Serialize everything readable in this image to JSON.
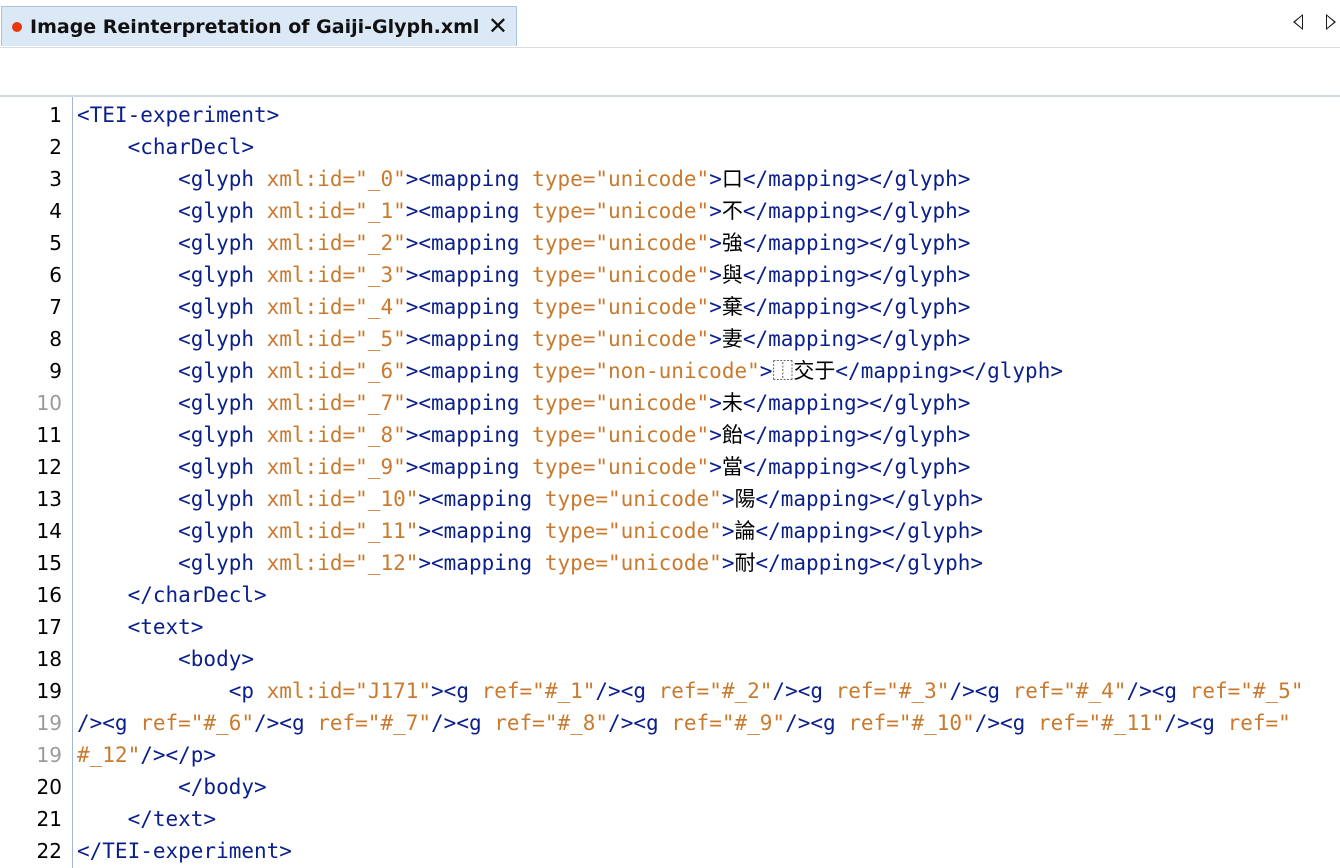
{
  "tab": {
    "title": "Image Reinterpretation of Gaiji-Glyph.xml",
    "close_label": "✕",
    "modified": true
  },
  "colors": {
    "tag": "#0b1f8a",
    "attribute": "#c97a2e",
    "text": "#000000",
    "tab_bg": "#dbe8f6",
    "modified_dot": "#e8380d"
  },
  "lines": [
    {
      "num": "1",
      "dim": false,
      "tokens": [
        {
          "t": "tag",
          "s": "<TEI-experiment>"
        }
      ]
    },
    {
      "num": "2",
      "dim": false,
      "tokens": [
        {
          "t": "tag",
          "s": "    <charDecl>"
        }
      ]
    },
    {
      "num": "3",
      "dim": false,
      "tokens": [
        {
          "t": "tag",
          "s": "        <glyph "
        },
        {
          "t": "attr",
          "s": "xml:id=\"_0\""
        },
        {
          "t": "tag",
          "s": "><mapping "
        },
        {
          "t": "attr",
          "s": "type=\"unicode\""
        },
        {
          "t": "tag",
          "s": ">"
        },
        {
          "t": "txt",
          "s": "口"
        },
        {
          "t": "tag",
          "s": "</mapping></glyph>"
        }
      ]
    },
    {
      "num": "4",
      "dim": false,
      "tokens": [
        {
          "t": "tag",
          "s": "        <glyph "
        },
        {
          "t": "attr",
          "s": "xml:id=\"_1\""
        },
        {
          "t": "tag",
          "s": "><mapping "
        },
        {
          "t": "attr",
          "s": "type=\"unicode\""
        },
        {
          "t": "tag",
          "s": ">"
        },
        {
          "t": "txt",
          "s": "不"
        },
        {
          "t": "tag",
          "s": "</mapping></glyph>"
        }
      ]
    },
    {
      "num": "5",
      "dim": false,
      "tokens": [
        {
          "t": "tag",
          "s": "        <glyph "
        },
        {
          "t": "attr",
          "s": "xml:id=\"_2\""
        },
        {
          "t": "tag",
          "s": "><mapping "
        },
        {
          "t": "attr",
          "s": "type=\"unicode\""
        },
        {
          "t": "tag",
          "s": ">"
        },
        {
          "t": "txt",
          "s": "強"
        },
        {
          "t": "tag",
          "s": "</mapping></glyph>"
        }
      ]
    },
    {
      "num": "6",
      "dim": false,
      "tokens": [
        {
          "t": "tag",
          "s": "        <glyph "
        },
        {
          "t": "attr",
          "s": "xml:id=\"_3\""
        },
        {
          "t": "tag",
          "s": "><mapping "
        },
        {
          "t": "attr",
          "s": "type=\"unicode\""
        },
        {
          "t": "tag",
          "s": ">"
        },
        {
          "t": "txt",
          "s": "與"
        },
        {
          "t": "tag",
          "s": "</mapping></glyph>"
        }
      ]
    },
    {
      "num": "7",
      "dim": false,
      "tokens": [
        {
          "t": "tag",
          "s": "        <glyph "
        },
        {
          "t": "attr",
          "s": "xml:id=\"_4\""
        },
        {
          "t": "tag",
          "s": "><mapping "
        },
        {
          "t": "attr",
          "s": "type=\"unicode\""
        },
        {
          "t": "tag",
          "s": ">"
        },
        {
          "t": "txt",
          "s": "棄"
        },
        {
          "t": "tag",
          "s": "</mapping></glyph>"
        }
      ]
    },
    {
      "num": "8",
      "dim": false,
      "tokens": [
        {
          "t": "tag",
          "s": "        <glyph "
        },
        {
          "t": "attr",
          "s": "xml:id=\"_5\""
        },
        {
          "t": "tag",
          "s": "><mapping "
        },
        {
          "t": "attr",
          "s": "type=\"unicode\""
        },
        {
          "t": "tag",
          "s": ">"
        },
        {
          "t": "txt",
          "s": "妻"
        },
        {
          "t": "tag",
          "s": "</mapping></glyph>"
        }
      ]
    },
    {
      "num": "9",
      "dim": false,
      "tokens": [
        {
          "t": "tag",
          "s": "        <glyph "
        },
        {
          "t": "attr",
          "s": "xml:id=\"_6\""
        },
        {
          "t": "tag",
          "s": "><mapping "
        },
        {
          "t": "attr",
          "s": "type=\"non-unicode\""
        },
        {
          "t": "tag",
          "s": ">"
        },
        {
          "t": "txt",
          "s": "⿰交于"
        },
        {
          "t": "tag",
          "s": "</mapping></glyph>"
        }
      ]
    },
    {
      "num": "10",
      "dim": true,
      "tokens": [
        {
          "t": "tag",
          "s": "        <glyph "
        },
        {
          "t": "attr",
          "s": "xml:id=\"_7\""
        },
        {
          "t": "tag",
          "s": "><mapping "
        },
        {
          "t": "attr",
          "s": "type=\"unicode\""
        },
        {
          "t": "tag",
          "s": ">"
        },
        {
          "t": "txt",
          "s": "未"
        },
        {
          "t": "tag",
          "s": "</mapping></glyph>"
        }
      ]
    },
    {
      "num": "11",
      "dim": false,
      "tokens": [
        {
          "t": "tag",
          "s": "        <glyph "
        },
        {
          "t": "attr",
          "s": "xml:id=\"_8\""
        },
        {
          "t": "tag",
          "s": "><mapping "
        },
        {
          "t": "attr",
          "s": "type=\"unicode\""
        },
        {
          "t": "tag",
          "s": ">"
        },
        {
          "t": "txt",
          "s": "飴"
        },
        {
          "t": "tag",
          "s": "</mapping></glyph>"
        }
      ]
    },
    {
      "num": "12",
      "dim": false,
      "tokens": [
        {
          "t": "tag",
          "s": "        <glyph "
        },
        {
          "t": "attr",
          "s": "xml:id=\"_9\""
        },
        {
          "t": "tag",
          "s": "><mapping "
        },
        {
          "t": "attr",
          "s": "type=\"unicode\""
        },
        {
          "t": "tag",
          "s": ">"
        },
        {
          "t": "txt",
          "s": "當"
        },
        {
          "t": "tag",
          "s": "</mapping></glyph>"
        }
      ]
    },
    {
      "num": "13",
      "dim": false,
      "tokens": [
        {
          "t": "tag",
          "s": "        <glyph "
        },
        {
          "t": "attr",
          "s": "xml:id=\"_10\""
        },
        {
          "t": "tag",
          "s": "><mapping "
        },
        {
          "t": "attr",
          "s": "type=\"unicode\""
        },
        {
          "t": "tag",
          "s": ">"
        },
        {
          "t": "txt",
          "s": "陽"
        },
        {
          "t": "tag",
          "s": "</mapping></glyph>"
        }
      ]
    },
    {
      "num": "14",
      "dim": false,
      "tokens": [
        {
          "t": "tag",
          "s": "        <glyph "
        },
        {
          "t": "attr",
          "s": "xml:id=\"_11\""
        },
        {
          "t": "tag",
          "s": "><mapping "
        },
        {
          "t": "attr",
          "s": "type=\"unicode\""
        },
        {
          "t": "tag",
          "s": ">"
        },
        {
          "t": "txt",
          "s": "論"
        },
        {
          "t": "tag",
          "s": "</mapping></glyph>"
        }
      ]
    },
    {
      "num": "15",
      "dim": false,
      "tokens": [
        {
          "t": "tag",
          "s": "        <glyph "
        },
        {
          "t": "attr",
          "s": "xml:id=\"_12\""
        },
        {
          "t": "tag",
          "s": "><mapping "
        },
        {
          "t": "attr",
          "s": "type=\"unicode\""
        },
        {
          "t": "tag",
          "s": ">"
        },
        {
          "t": "txt",
          "s": "耐"
        },
        {
          "t": "tag",
          "s": "</mapping></glyph>"
        }
      ]
    },
    {
      "num": "16",
      "dim": false,
      "tokens": [
        {
          "t": "tag",
          "s": "    </charDecl>"
        }
      ]
    },
    {
      "num": "17",
      "dim": false,
      "tokens": [
        {
          "t": "tag",
          "s": "    <text>"
        }
      ]
    },
    {
      "num": "18",
      "dim": false,
      "tokens": [
        {
          "t": "tag",
          "s": "        <body>"
        }
      ]
    },
    {
      "num": "19",
      "dim": false,
      "tokens": [
        {
          "t": "tag",
          "s": "            <p "
        },
        {
          "t": "attr",
          "s": "xml:id=\"J171\""
        },
        {
          "t": "tag",
          "s": "><g "
        },
        {
          "t": "attr",
          "s": "ref=\"#_1\""
        },
        {
          "t": "tag",
          "s": "/><g "
        },
        {
          "t": "attr",
          "s": "ref=\"#_2\""
        },
        {
          "t": "tag",
          "s": "/><g "
        },
        {
          "t": "attr",
          "s": "ref=\"#_3\""
        },
        {
          "t": "tag",
          "s": "/><g "
        },
        {
          "t": "attr",
          "s": "ref=\"#_4\""
        },
        {
          "t": "tag",
          "s": "/><g "
        },
        {
          "t": "attr",
          "s": "ref=\"#_5\""
        }
      ]
    },
    {
      "num": "19",
      "dim": true,
      "tokens": [
        {
          "t": "tag",
          "s": "/><g "
        },
        {
          "t": "attr",
          "s": "ref=\"#_6\""
        },
        {
          "t": "tag",
          "s": "/><g "
        },
        {
          "t": "attr",
          "s": "ref=\"#_7\""
        },
        {
          "t": "tag",
          "s": "/><g "
        },
        {
          "t": "attr",
          "s": "ref=\"#_8\""
        },
        {
          "t": "tag",
          "s": "/><g "
        },
        {
          "t": "attr",
          "s": "ref=\"#_9\""
        },
        {
          "t": "tag",
          "s": "/><g "
        },
        {
          "t": "attr",
          "s": "ref=\"#_10\""
        },
        {
          "t": "tag",
          "s": "/><g "
        },
        {
          "t": "attr",
          "s": "ref=\"#_11\""
        },
        {
          "t": "tag",
          "s": "/><g "
        },
        {
          "t": "attr",
          "s": "ref=\""
        }
      ]
    },
    {
      "num": "19",
      "dim": true,
      "tokens": [
        {
          "t": "attr",
          "s": "#_12\""
        },
        {
          "t": "tag",
          "s": "/></p>"
        }
      ]
    },
    {
      "num": "20",
      "dim": false,
      "tokens": [
        {
          "t": "tag",
          "s": "        </body>"
        }
      ]
    },
    {
      "num": "21",
      "dim": false,
      "tokens": [
        {
          "t": "tag",
          "s": "    </text>"
        }
      ]
    },
    {
      "num": "22",
      "dim": false,
      "tokens": [
        {
          "t": "tag",
          "s": "</TEI-experiment>"
        }
      ]
    }
  ]
}
